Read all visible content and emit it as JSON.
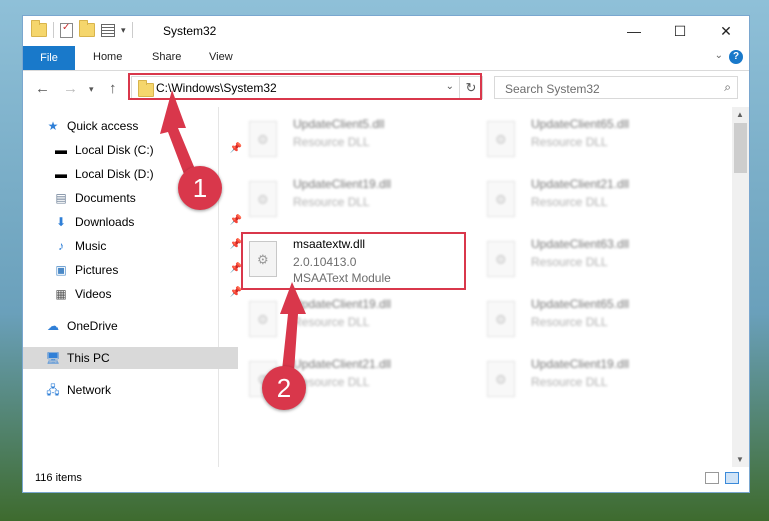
{
  "window": {
    "title": "System32",
    "controls": {
      "minimize": "—",
      "maximize": "☐",
      "close": "✕"
    }
  },
  "ribbon": {
    "tabs": [
      "File",
      "Home",
      "Share",
      "View"
    ],
    "help": "?"
  },
  "address": {
    "path": "C:\\Windows\\System32",
    "search_placeholder": "Search System32"
  },
  "nav": {
    "items": [
      {
        "label": "Quick access",
        "icon": "star-icon",
        "pinned": false
      },
      {
        "label": "Local Disk (C:)",
        "icon": "drive-icon",
        "pinned": true
      },
      {
        "label": "Local Disk (D:)",
        "icon": "drive-icon",
        "pinned": false
      },
      {
        "label": "Documents",
        "icon": "documents-icon",
        "pinned": false
      },
      {
        "label": "Downloads",
        "icon": "downloads-icon",
        "pinned": true
      },
      {
        "label": "Music",
        "icon": "music-icon",
        "pinned": true
      },
      {
        "label": "Pictures",
        "icon": "pictures-icon",
        "pinned": true
      },
      {
        "label": "Videos",
        "icon": "videos-icon",
        "pinned": true
      },
      {
        "label": "OneDrive",
        "icon": "onedrive-icon",
        "pinned": false
      },
      {
        "label": "This PC",
        "icon": "computer-icon",
        "pinned": false,
        "selected": true
      },
      {
        "label": "Network",
        "icon": "network-icon",
        "pinned": false
      }
    ]
  },
  "files": {
    "left": [
      {
        "name": "UpdateClient5.dll",
        "type": "Resource DLL"
      },
      {
        "name": "UpdateClient19.dll",
        "type": "Resource DLL"
      },
      {
        "name": "msaatextw.dll",
        "version": "2.0.10413.0",
        "description": "MSAAText Module"
      },
      {
        "name": "UpdateClient19.dll",
        "type": "Resource DLL"
      },
      {
        "name": "UpdateClient21.dll",
        "type": "Resource DLL"
      }
    ],
    "right": [
      {
        "name": "UpdateClient65.dll",
        "type": "Resource DLL"
      },
      {
        "name": "UpdateClient21.dll",
        "type": "Resource DLL"
      },
      {
        "name": "UpdateClient63.dll",
        "type": "Resource DLL"
      },
      {
        "name": "UpdateClient65.dll",
        "type": "Resource DLL"
      },
      {
        "name": "UpdateClient19.dll",
        "type": "Resource DLL"
      }
    ]
  },
  "status": {
    "item_count": "116 items"
  },
  "annotations": {
    "step1": "1",
    "step2": "2",
    "color": "#d9374b"
  }
}
